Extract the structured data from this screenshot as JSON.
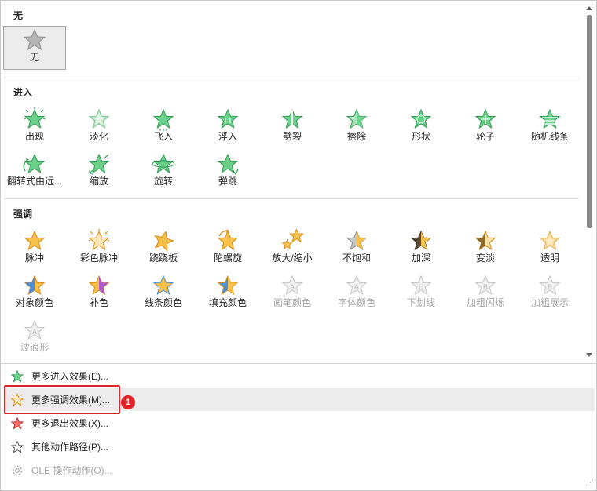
{
  "sections": {
    "none": {
      "title": "无",
      "items": [
        {
          "label": "无",
          "icon": "gray-star-icon",
          "selected": true
        }
      ]
    },
    "entrance": {
      "title": "进入",
      "items": [
        {
          "label": "出现",
          "icon": "green-star-burst-icon"
        },
        {
          "label": "淡化",
          "icon": "green-star-fade-icon"
        },
        {
          "label": "飞入",
          "icon": "green-star-fly-icon"
        },
        {
          "label": "浮入",
          "icon": "green-star-float-icon"
        },
        {
          "label": "劈裂",
          "icon": "green-star-split-icon"
        },
        {
          "label": "擦除",
          "icon": "green-star-wipe-icon"
        },
        {
          "label": "形状",
          "icon": "green-star-shape-icon"
        },
        {
          "label": "轮子",
          "icon": "green-star-wheel-icon"
        },
        {
          "label": "随机线条",
          "icon": "green-star-lines-icon"
        },
        {
          "label": "翻转式由远...",
          "icon": "green-star-flip-icon"
        },
        {
          "label": "缩放",
          "icon": "green-star-zoom-icon"
        },
        {
          "label": "旋转",
          "icon": "green-star-swivel-icon"
        },
        {
          "label": "弹跳",
          "icon": "green-star-bounce-icon"
        }
      ]
    },
    "emphasis": {
      "title": "强调",
      "items": [
        {
          "label": "脉冲",
          "icon": "orange-star-pulse-icon"
        },
        {
          "label": "彩色脉冲",
          "icon": "orange-star-color-pulse-icon"
        },
        {
          "label": "跷跷板",
          "icon": "orange-star-teeter-icon"
        },
        {
          "label": "陀螺旋",
          "icon": "orange-star-spin-icon"
        },
        {
          "label": "放大/缩小",
          "icon": "orange-star-grow-shrink-icon"
        },
        {
          "label": "不饱和",
          "icon": "desaturate-star-icon"
        },
        {
          "label": "加深",
          "icon": "darken-star-icon"
        },
        {
          "label": "变淡",
          "icon": "lighten-star-icon"
        },
        {
          "label": "透明",
          "icon": "transparency-star-icon"
        },
        {
          "label": "对象颜色",
          "icon": "object-color-star-icon"
        },
        {
          "label": "补色",
          "icon": "complementary-color-star-icon"
        },
        {
          "label": "线条颜色",
          "icon": "line-color-star-icon"
        },
        {
          "label": "填充颜色",
          "icon": "fill-color-star-icon"
        },
        {
          "label": "画笔颜色",
          "icon": "brush-color-star-icon",
          "disabled": true
        },
        {
          "label": "字体颜色",
          "icon": "font-color-star-icon",
          "disabled": true
        },
        {
          "label": "下划线",
          "icon": "underline-star-icon",
          "disabled": true
        },
        {
          "label": "加粗闪烁",
          "icon": "bold-flash-star-icon",
          "disabled": true
        },
        {
          "label": "加粗展示",
          "icon": "bold-reveal-star-icon",
          "disabled": true
        },
        {
          "label": "波浪形",
          "icon": "wave-star-icon",
          "disabled": true
        }
      ]
    }
  },
  "menu": [
    {
      "label": "更多进入效果(E)...",
      "icon": "green-star-icon"
    },
    {
      "label": "更多强调效果(M)...",
      "icon": "orange-burst-star-icon",
      "hover": true
    },
    {
      "label": "更多退出效果(X)...",
      "icon": "red-star-icon"
    },
    {
      "label": "其他动作路径(P)...",
      "icon": "outline-star-icon"
    },
    {
      "label": "OLE 操作动作(O)...",
      "icon": "gear-icon",
      "disabled": true
    }
  ],
  "annotation": {
    "badge": "1"
  },
  "colors": {
    "green": "#5fc27a",
    "orange": "#f5a623",
    "red": "#e24a4a",
    "gray": "#9a9a9a",
    "highlight": "#e0242b"
  }
}
